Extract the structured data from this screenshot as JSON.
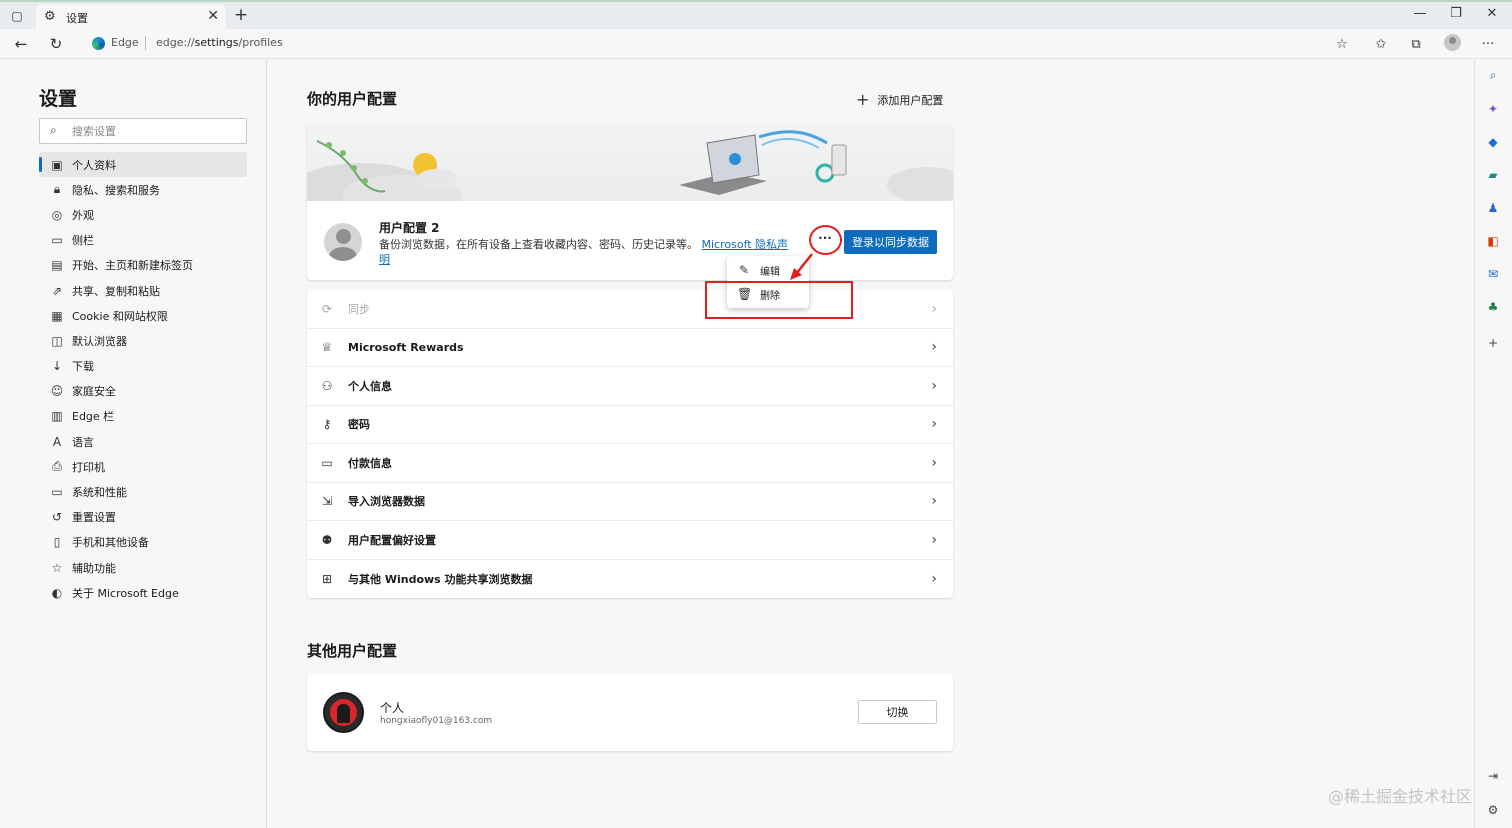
{
  "tab": {
    "title": "设置"
  },
  "addressbar": {
    "site_label": "Edge",
    "url_prefix": "edge://",
    "url_host": "settings",
    "url_path": "/profiles"
  },
  "sidebar": {
    "title": "设置",
    "search_placeholder": "搜索设置",
    "items": [
      {
        "label": "个人资料",
        "icon": "profile-icon"
      },
      {
        "label": "隐私、搜索和服务",
        "icon": "lock-icon"
      },
      {
        "label": "外观",
        "icon": "palette-icon"
      },
      {
        "label": "侧栏",
        "icon": "sidebar-icon"
      },
      {
        "label": "开始、主页和新建标签页",
        "icon": "home-icon"
      },
      {
        "label": "共享、复制和粘贴",
        "icon": "share-icon"
      },
      {
        "label": "Cookie 和网站权限",
        "icon": "cookie-icon"
      },
      {
        "label": "默认浏览器",
        "icon": "browser-icon"
      },
      {
        "label": "下载",
        "icon": "download-icon"
      },
      {
        "label": "家庭安全",
        "icon": "family-icon"
      },
      {
        "label": "Edge 栏",
        "icon": "edge-bar-icon"
      },
      {
        "label": "语言",
        "icon": "language-icon"
      },
      {
        "label": "打印机",
        "icon": "printer-icon"
      },
      {
        "label": "系统和性能",
        "icon": "laptop-icon"
      },
      {
        "label": "重置设置",
        "icon": "reset-icon"
      },
      {
        "label": "手机和其他设备",
        "icon": "phone-icon"
      },
      {
        "label": "辅助功能",
        "icon": "accessibility-icon"
      },
      {
        "label": "关于 Microsoft Edge",
        "icon": "edge-icon"
      }
    ]
  },
  "main": {
    "your_profiles_title": "你的用户配置",
    "add_profile_label": "添加用户配置",
    "profile": {
      "name": "用户配置 2",
      "desc": "备份浏览数据，在所有设备上查看收藏内容、密码、历史记录等。",
      "privacy_link": "Microsoft 隐私声明",
      "more_label": "···",
      "signin_label": "登录以同步数据"
    },
    "menu": {
      "edit_label": "编辑",
      "delete_label": "删除"
    },
    "rows": [
      {
        "label": "同步",
        "icon": "sync-icon",
        "disabled": true
      },
      {
        "label": "Microsoft Rewards",
        "icon": "trophy-icon"
      },
      {
        "label": "个人信息",
        "icon": "person-card-icon"
      },
      {
        "label": "密码",
        "icon": "key-icon"
      },
      {
        "label": "付款信息",
        "icon": "card-icon"
      },
      {
        "label": "导入浏览器数据",
        "icon": "import-icon"
      },
      {
        "label": "用户配置偏好设置",
        "icon": "people-settings-icon"
      },
      {
        "label": "与其他 Windows 功能共享浏览数据",
        "icon": "windows-icon"
      }
    ],
    "other_profiles_title": "其他用户配置",
    "other_profile": {
      "name": "个人",
      "email": "hongxiaofly01@163.com",
      "switch_label": "切换"
    }
  },
  "watermark": "@稀土掘金技术社区",
  "colors": {
    "accent": "#0f6cbd",
    "highlight": "#e02020"
  }
}
